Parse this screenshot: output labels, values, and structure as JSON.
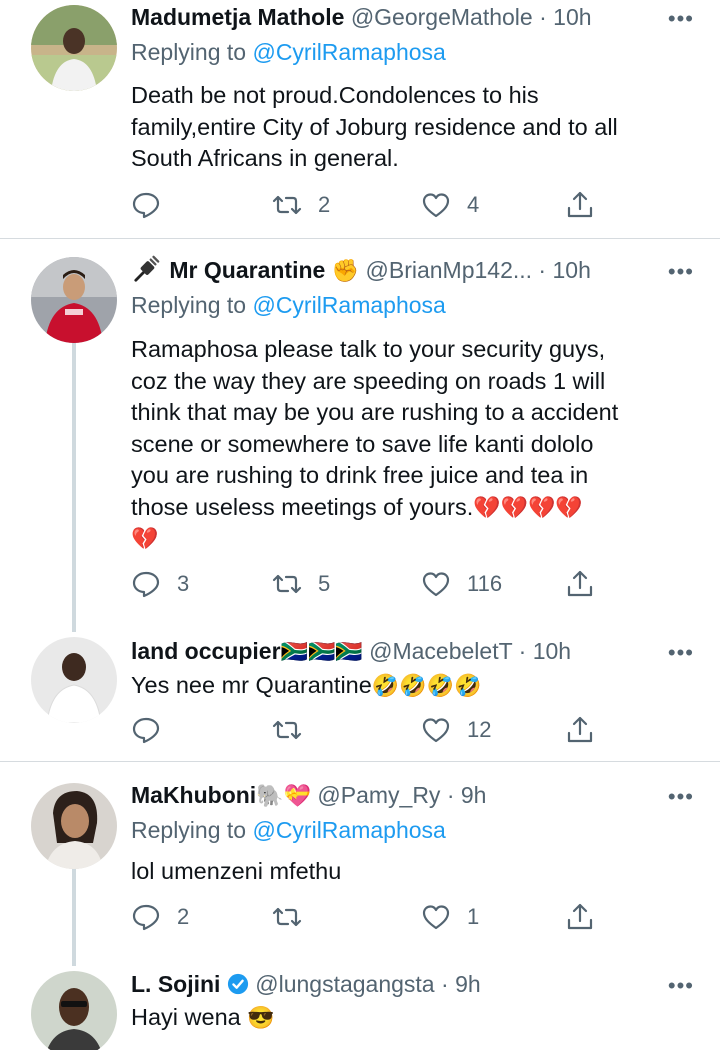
{
  "tweets": [
    {
      "name": "Madumetja Mathole",
      "handle": "@GeorgeMathole",
      "time": "10h",
      "replying_prefix": "Replying to ",
      "replying_to": "@CyrilRamaphosa",
      "text_lines": [
        "Death be not proud.Condolences to his",
        "family,entire City of Joburg residence and to all",
        "South Africans in general."
      ],
      "replies": "",
      "retweets": "2",
      "likes": "4",
      "avatar_icon": "person-avatar"
    },
    {
      "name_prefix_icon": "plug-icon",
      "name": "Mr Quarantine",
      "name_suffix_emoji": "✊",
      "handle": "@BrianMp142...",
      "time": "10h",
      "replying_prefix": "Replying to ",
      "replying_to": "@CyrilRamaphosa",
      "text_lines": [
        "Ramaphosa please talk to your security guys,",
        "coz the way they are speeding on roads 1 will",
        "think that may be you are rushing to a accident",
        "scene or somewhere to save life kanti dololo",
        "you are rushing to drink free juice and tea in",
        "those useless meetings of yours."
      ],
      "text_emoji_tail": "💔💔💔💔",
      "text_emoji_line": "💔",
      "replies": "3",
      "retweets": "5",
      "likes": "116",
      "avatar_icon": "footballer-avatar"
    },
    {
      "name": "land occupier",
      "name_suffix_emoji": "🇿🇦🇿🇦🇿🇦",
      "handle": "@MacebeletT",
      "time": "10h",
      "text": "Yes nee mr Quarantine",
      "text_emoji_tail": "🤣🤣🤣🤣",
      "replies": "",
      "retweets": "",
      "likes": "12",
      "avatar_icon": "person-avatar"
    },
    {
      "name": "MaKhuboni",
      "name_suffix_emoji": "🐘💝",
      "handle": "@Pamy_Ry",
      "time": "9h",
      "replying_prefix": "Replying to ",
      "replying_to": "@CyrilRamaphosa",
      "text": "lol umenzeni mfethu",
      "replies": "2",
      "retweets": "",
      "likes": "1",
      "avatar_icon": "person-avatar"
    },
    {
      "name": "L. Sojini",
      "verified": true,
      "handle": "@lungstagangsta",
      "time": "9h",
      "text": "Hayi wena",
      "text_emoji_tail": "😎",
      "avatar_icon": "person-avatar"
    }
  ],
  "separator": " · ",
  "more_label": "•••",
  "colors": {
    "text": "#0f1419",
    "secondary": "#536471",
    "link": "#1d9bf0",
    "thread_line": "#cfd9de",
    "divider": "#d6dbdf"
  }
}
